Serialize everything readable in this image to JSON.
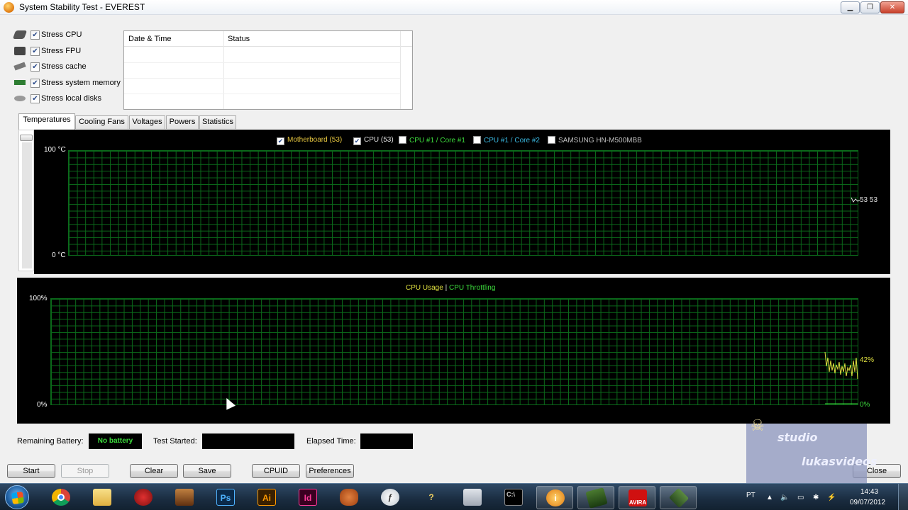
{
  "window": {
    "title": "System Stability Test - EVEREST",
    "minimize_icon": "minimize-icon",
    "restore_icon": "restore-icon",
    "close_icon": "close-icon"
  },
  "stress_options": [
    {
      "label": "Stress CPU",
      "checked": true,
      "icon": "cpu-icon"
    },
    {
      "label": "Stress FPU",
      "checked": true,
      "icon": "fpu-icon"
    },
    {
      "label": "Stress cache",
      "checked": true,
      "icon": "cache-icon"
    },
    {
      "label": "Stress system memory",
      "checked": true,
      "icon": "memory-icon"
    },
    {
      "label": "Stress local disks",
      "checked": true,
      "icon": "disk-icon"
    }
  ],
  "log_table": {
    "columns": [
      "Date & Time",
      "Status"
    ],
    "rows": []
  },
  "tabs": [
    "Temperatures",
    "Cooling Fans",
    "Voltages",
    "Powers",
    "Statistics"
  ],
  "active_tab": "Temperatures",
  "temperature_graph": {
    "legend": [
      {
        "label": "Motherboard (53)",
        "checked": true,
        "color": "#e8c840"
      },
      {
        "label": "CPU (53)",
        "checked": true,
        "color": "#e0e0e0"
      },
      {
        "label": "CPU #1 / Core #1",
        "checked": false,
        "color": "#3ddc3d"
      },
      {
        "label": "CPU #1 / Core #2",
        "checked": false,
        "color": "#3ab8e0"
      },
      {
        "label": "SAMSUNG HN-M500MBB",
        "checked": false,
        "color": "#c0c0c0"
      }
    ],
    "y_max_label": "100 °C",
    "y_min_label": "0 °C",
    "current_values": "53 53",
    "grid_color": "#0b6a1a"
  },
  "cpu_graph": {
    "legend_usage": "CPU Usage",
    "legend_separator": "|",
    "legend_throttling": "CPU Throttling",
    "usage_color": "#e0e040",
    "throttling_color": "#3ddc3d",
    "y_max_label": "100%",
    "y_min_label": "0%",
    "usage_value": "42%",
    "throttling_value": "0%"
  },
  "status": {
    "battery_label": "Remaining Battery:",
    "battery_value": "No battery",
    "test_started_label": "Test Started:",
    "test_started_value": "",
    "elapsed_label": "Elapsed Time:",
    "elapsed_value": ""
  },
  "buttons": {
    "start": "Start",
    "stop": "Stop",
    "clear": "Clear",
    "save": "Save",
    "cpuid": "CPUID",
    "preferences": "Preferences",
    "close": "Close"
  },
  "watermark": {
    "line1": "studio",
    "line2": "lukasvideos"
  },
  "taskbar": {
    "apps": [
      "chrome-icon",
      "explorer-icon",
      "red-app-icon",
      "portrait-app-icon",
      "photoshop-icon",
      "illustrator-icon",
      "indesign-icon",
      "baseball-glove-icon",
      "flash-icon",
      "help-tool-icon",
      "pc-icon",
      "cmd-icon",
      "everest-icon",
      "gpu-z-icon",
      "avira-icon",
      "game-icon"
    ],
    "photoshop_text": "Ps",
    "illustrator_text": "Ai",
    "indesign_text": "Id",
    "avira_text": "AVIRA",
    "language": "PT",
    "time": "14:43",
    "date": "09/07/2012"
  }
}
